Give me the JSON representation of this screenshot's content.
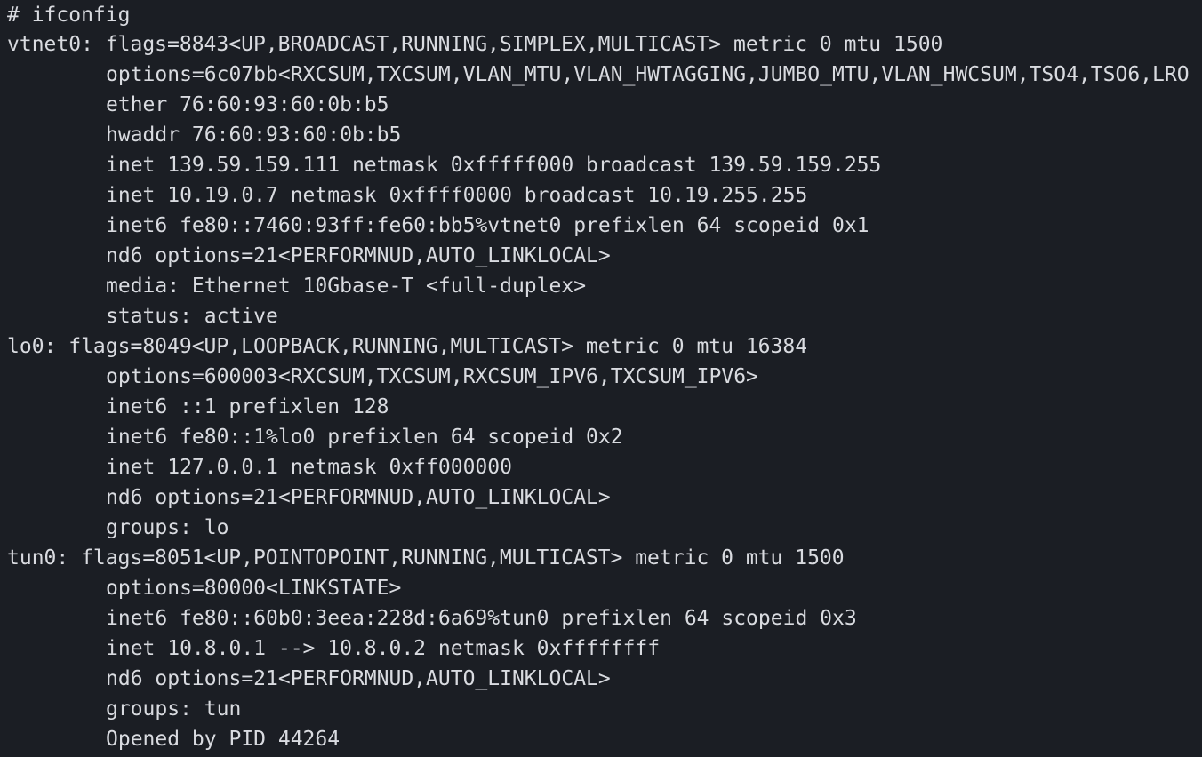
{
  "terminal": {
    "prompt_line": "# ifconfig",
    "lines": [
      {
        "text": "vtnet0: flags=8843<UP,BROADCAST,RUNNING,SIMPLEX,MULTICAST> metric 0 mtu 1500"
      },
      {
        "text": "options=6c07bb<RXCSUM,TXCSUM,VLAN_MTU,VLAN_HWTAGGING,JUMBO_MTU,VLAN_HWCSUM,TSO4,TSO6,LRO"
      },
      {
        "text": "ether 76:60:93:60:0b:b5"
      },
      {
        "text": "hwaddr 76:60:93:60:0b:b5"
      },
      {
        "text": "inet 139.59.159.111 netmask 0xfffff000 broadcast 139.59.159.255"
      },
      {
        "text": "inet 10.19.0.7 netmask 0xffff0000 broadcast 10.19.255.255"
      },
      {
        "text": "inet6 fe80::7460:93ff:fe60:bb5%vtnet0 prefixlen 64 scopeid 0x1"
      },
      {
        "text": "nd6 options=21<PERFORMNUD,AUTO_LINKLOCAL>"
      },
      {
        "text": "media: Ethernet 10Gbase-T <full-duplex>"
      },
      {
        "text": "status: active"
      },
      {
        "text": "lo0: flags=8049<UP,LOOPBACK,RUNNING,MULTICAST> metric 0 mtu 16384"
      },
      {
        "text": "options=600003<RXCSUM,TXCSUM,RXCSUM_IPV6,TXCSUM_IPV6>"
      },
      {
        "text": "inet6 ::1 prefixlen 128"
      },
      {
        "text": "inet6 fe80::1%lo0 prefixlen 64 scopeid 0x2"
      },
      {
        "text": "inet 127.0.0.1 netmask 0xff000000"
      },
      {
        "text": "nd6 options=21<PERFORMNUD,AUTO_LINKLOCAL>"
      },
      {
        "text": "groups: lo"
      },
      {
        "text": "tun0: flags=8051<UP,POINTOPOINT,RUNNING,MULTICAST> metric 0 mtu 1500"
      },
      {
        "text": "options=80000<LINKSTATE>"
      },
      {
        "text": "inet6 fe80::60b0:3eea:228d:6a69%tun0 prefixlen 64 scopeid 0x3"
      },
      {
        "text": "inet 10.8.0.1 --> 10.8.0.2 netmask 0xffffffff"
      },
      {
        "text": "nd6 options=21<PERFORMNUD,AUTO_LINKLOCAL>"
      },
      {
        "text": "groups: tun"
      },
      {
        "text": "Opened by PID 44264"
      }
    ]
  }
}
